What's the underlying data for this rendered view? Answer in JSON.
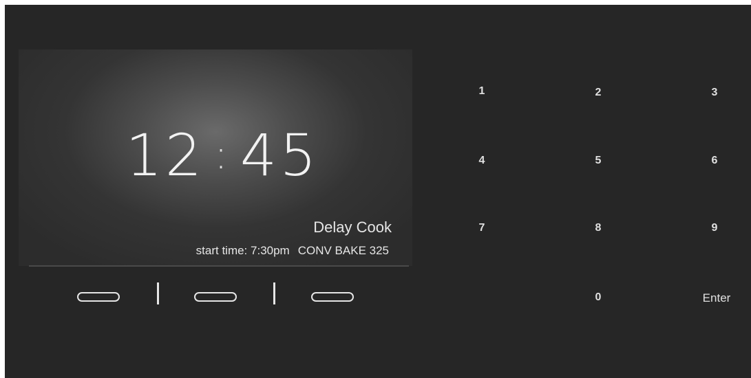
{
  "display": {
    "clock_hours": "12",
    "clock_separator": ":",
    "clock_minutes": "45",
    "mode_label": "Delay Cook",
    "start_time_label": "start time:",
    "start_time_value": "7:30pm",
    "cook_mode": "CONV BAKE 325"
  },
  "softkeys": {
    "count": 3,
    "divider_count": 2
  },
  "keypad": {
    "keys": [
      "1",
      "2",
      "3",
      "4",
      "5",
      "6",
      "7",
      "8",
      "9",
      "0",
      "Enter"
    ]
  },
  "colors": {
    "panel_background": "#262626",
    "text": "#e6e6e6"
  }
}
